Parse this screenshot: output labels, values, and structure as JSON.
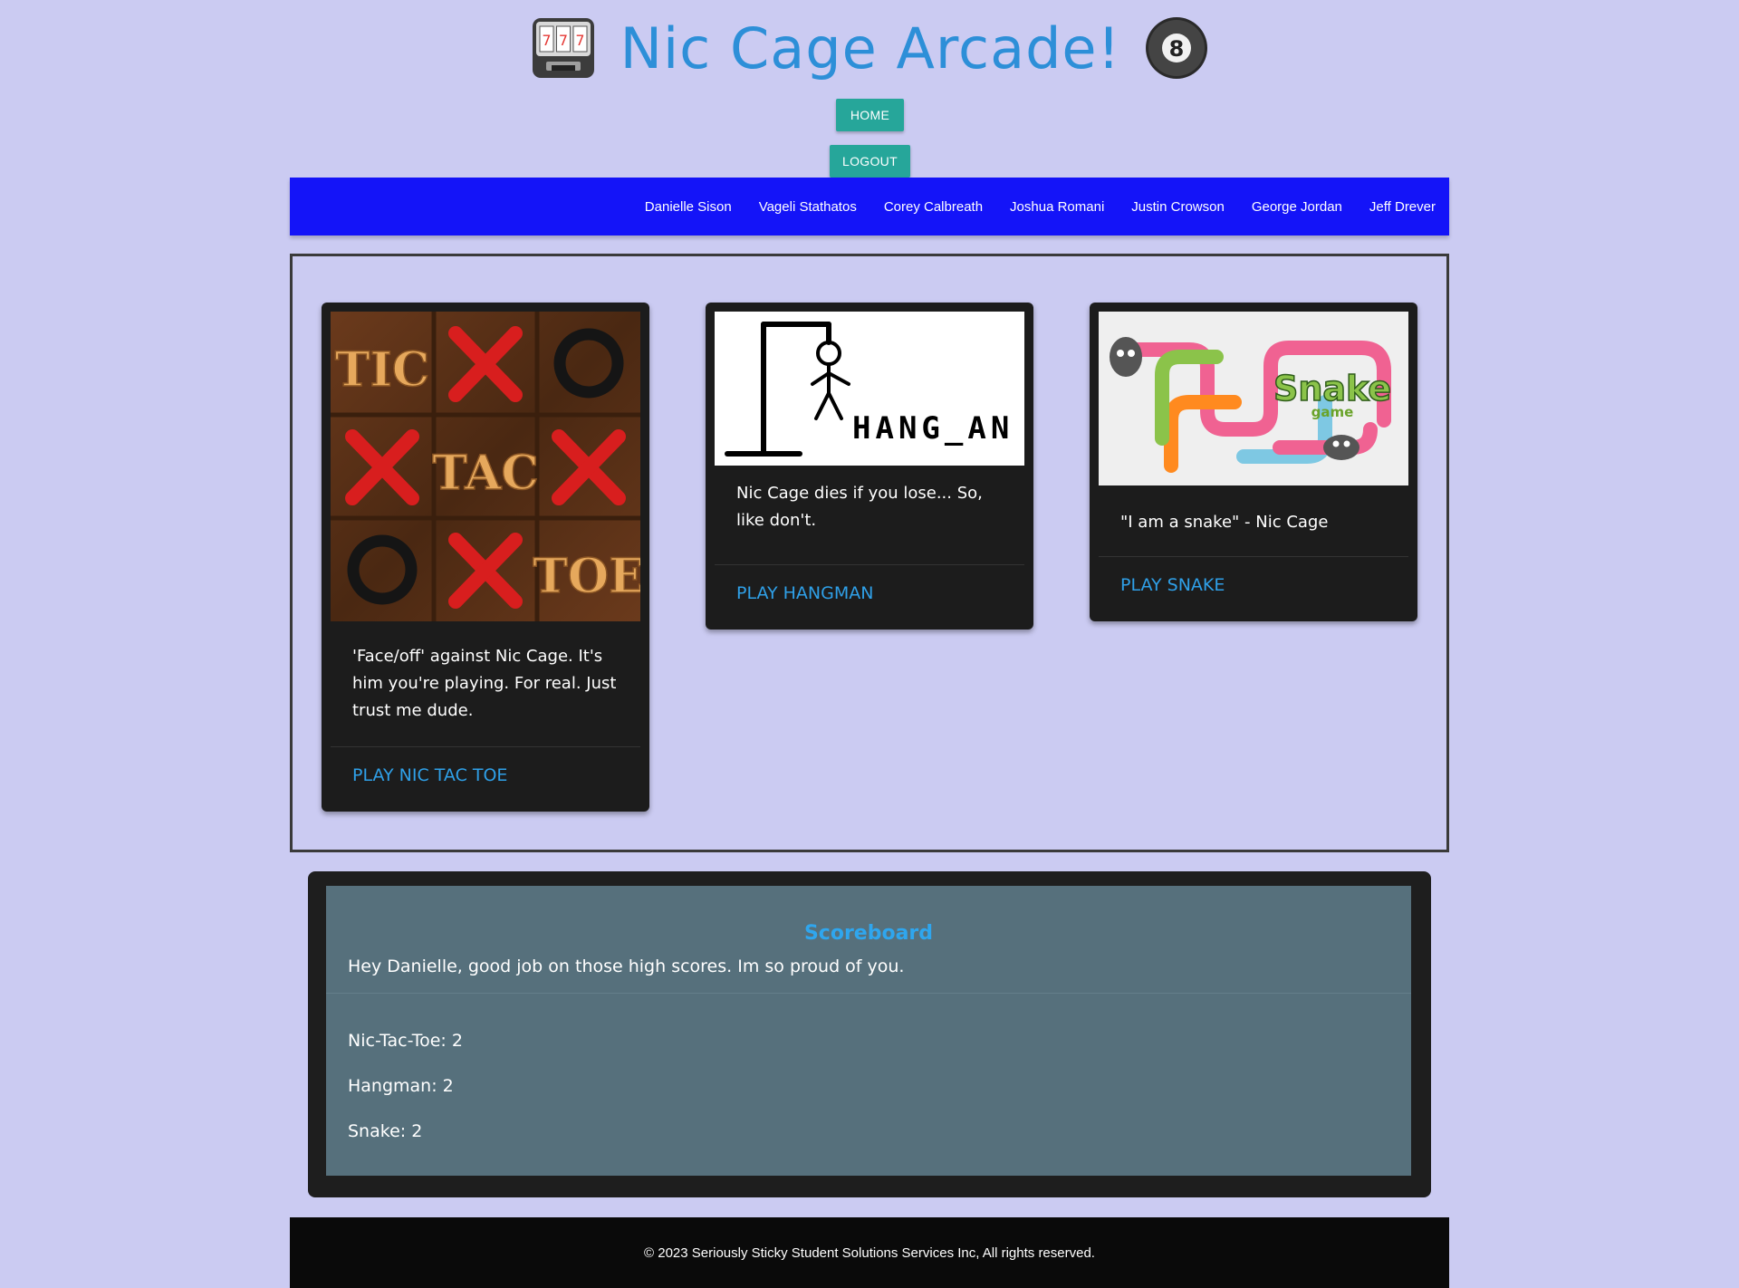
{
  "header": {
    "title": "Nic Cage Arcade!",
    "left_icon": "slot-machine-icon",
    "right_icon": "8-ball-icon"
  },
  "buttons": {
    "home": "HOME",
    "logout": "LOGOUT"
  },
  "nav": {
    "items": [
      "Danielle Sison",
      "Vageli Stathatos",
      "Corey Calbreath",
      "Joshua Romani",
      "Justin Crowson",
      "George Jordan",
      "Jeff Drever"
    ]
  },
  "games": [
    {
      "image": "tic-tac-toe-image",
      "description": "'Face/off' against Nic Cage. It's him you're playing. For real. Just trust me dude.",
      "link": "PLAY NIC TAC TOE",
      "image_text": [
        "TIC",
        "TAC",
        "TOE"
      ]
    },
    {
      "image": "hangman-image",
      "description": "Nic Cage dies if you lose... So, like don't.",
      "link": "PLAY HANGMAN",
      "image_text": "HANG_AN"
    },
    {
      "image": "snake-image",
      "description": "\"I am a snake\" - Nic Cage",
      "link": "PLAY SNAKE",
      "image_text": [
        "Snake",
        "game"
      ]
    }
  ],
  "scoreboard": {
    "title": "Scoreboard",
    "message": "Hey Danielle, good job on those high scores. Im so proud of you.",
    "scores": [
      "Nic-Tac-Toe: 2",
      "Hangman: 2",
      "Snake: 2"
    ]
  },
  "footer": {
    "text": "© 2023 Seriously Sticky Student Solutions Services Inc, All rights reserved."
  },
  "colors": {
    "background": "#cbcbf2",
    "accent": "#2d8fd8",
    "nav": "#1414f8",
    "button": "#26a69a"
  }
}
